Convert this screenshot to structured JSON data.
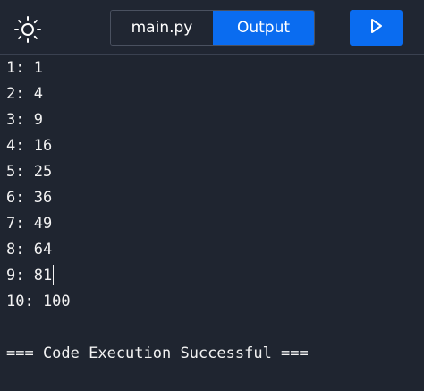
{
  "toolbar": {
    "theme_icon": "sun-icon",
    "file_tab_label": "main.py",
    "output_tab_label": "Output",
    "run_icon": "play-icon"
  },
  "console": {
    "lines": [
      "1: 1",
      "2: 4",
      "3: 9",
      "4: 16",
      "5: 25",
      "6: 36",
      "7: 49",
      "8: 64",
      "9: 81",
      "10: 100"
    ],
    "status": "=== Code Execution Successful ==="
  },
  "colors": {
    "background": "#1f2530",
    "accent": "#0a6cf0",
    "text": "#f2f2f2"
  }
}
